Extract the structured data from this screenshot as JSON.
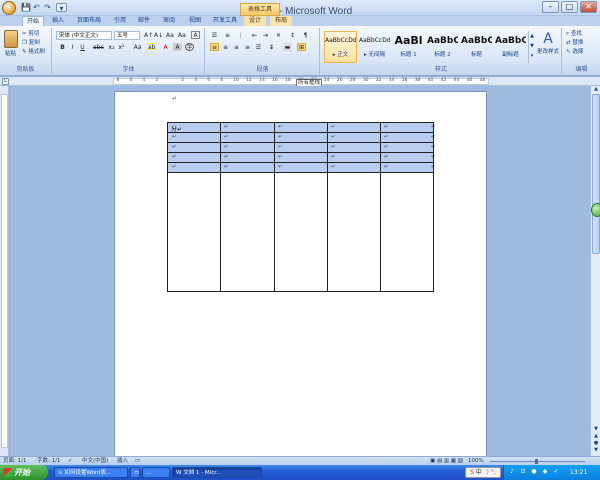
{
  "window": {
    "title": "文档 1 - Microsoft Word",
    "context_tab_group": "表格工具",
    "controls": {
      "minimize": "–",
      "maximize": "□",
      "close": "✕"
    }
  },
  "quick_access": [
    "💾",
    "↶",
    "↷",
    "▾"
  ],
  "tabs": [
    {
      "label": "开始",
      "active": true
    },
    {
      "label": "插入"
    },
    {
      "label": "页面布局"
    },
    {
      "label": "引用"
    },
    {
      "label": "邮件"
    },
    {
      "label": "审阅"
    },
    {
      "label": "视图"
    },
    {
      "label": "开发工具"
    },
    {
      "label": "设计",
      "context": true
    },
    {
      "label": "布局",
      "context": true
    }
  ],
  "ribbon": {
    "clipboard": {
      "label": "剪贴板",
      "paste": "粘贴",
      "cut": "剪切",
      "copy": "复制",
      "format_painter": "格式刷"
    },
    "font": {
      "label": "字体",
      "font_name": "宋体 (中文正文)",
      "font_size": "五号",
      "bold": "B",
      "italic": "I",
      "underline": "U",
      "strike": "abc",
      "sub": "x₂",
      "sup": "x²",
      "clear": "Aa",
      "font_color": "A",
      "grow": "A↑",
      "shrink": "A↓"
    },
    "paragraph": {
      "label": "段落"
    },
    "styles": {
      "label": "样式",
      "items": [
        {
          "preview": "AaBbCcDd",
          "name": "▸ 正文",
          "selected": true
        },
        {
          "preview": "AaBbCcDd",
          "name": "▸ 无间隔"
        },
        {
          "preview": "AaBl",
          "name": "标题 1"
        },
        {
          "preview": "AaBbC",
          "name": "标题 2"
        },
        {
          "preview": "AaBbC",
          "name": "标题"
        },
        {
          "preview": "AaBbC",
          "name": "副标题"
        }
      ],
      "change_styles": "更改样式"
    },
    "editing": {
      "label": "编辑",
      "find": "查找",
      "replace": "替换",
      "select": "选择"
    }
  },
  "ruler": {
    "tooltip": "所有框线",
    "numbers": [
      "8",
      "6",
      "4",
      "2",
      "",
      "2",
      "4",
      "6",
      "8",
      "10",
      "12",
      "14",
      "16",
      "18",
      "20",
      "22",
      "24",
      "26",
      "28",
      "30",
      "32",
      "34",
      "36",
      "38",
      "40",
      "42",
      "44",
      "46",
      "48"
    ]
  },
  "table": {
    "first_cell": "分",
    "cell_mark": "↵",
    "columns": 5,
    "selected_rows": 5
  },
  "status": {
    "page": "页面: 1/1",
    "words": "字数: 1/1",
    "language": "中文(中国)",
    "mode": "插入",
    "zoom": "100%"
  },
  "taskbar": {
    "start": "开始",
    "tasks": [
      "如何设置Word表...",
      "...",
      "文档 1 - Micr..."
    ],
    "clock": "13:21",
    "ime": "中"
  }
}
